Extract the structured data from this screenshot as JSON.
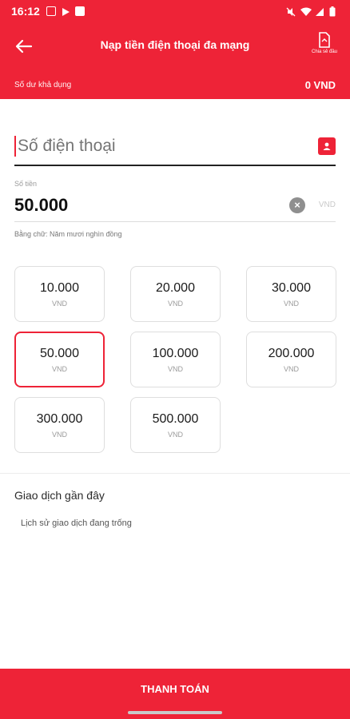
{
  "status_bar": {
    "time": "16:12",
    "left_icons": [
      "image-icon",
      "play-store-icon",
      "calendar-check-icon"
    ],
    "right_icons": [
      "mute-icon",
      "wifi-icon",
      "signal-icon",
      "battery-icon"
    ]
  },
  "header": {
    "title": "Nạp tiền điện thoại đa mạng",
    "share_label": "Chia sẻ đầu",
    "back_icon": "back-arrow-icon"
  },
  "balance": {
    "label": "Số dư khả dụng",
    "value": "0 VND"
  },
  "phone": {
    "placeholder": "Số điện thoại",
    "contact_icon": "contact-book-icon"
  },
  "amount": {
    "label": "Số tiền",
    "value": "50.000",
    "unit": "VND",
    "words": "Bằng chữ: Năm mươi nghìn đồng"
  },
  "denominations": [
    {
      "value": "10.000",
      "unit": "VND",
      "selected": false
    },
    {
      "value": "20.000",
      "unit": "VND",
      "selected": false
    },
    {
      "value": "30.000",
      "unit": "VND",
      "selected": false
    },
    {
      "value": "50.000",
      "unit": "VND",
      "selected": true
    },
    {
      "value": "100.000",
      "unit": "VND",
      "selected": false
    },
    {
      "value": "200.000",
      "unit": "VND",
      "selected": false
    },
    {
      "value": "300.000",
      "unit": "VND",
      "selected": false
    },
    {
      "value": "500.000",
      "unit": "VND",
      "selected": false
    }
  ],
  "recent": {
    "title": "Giao dịch gần đây",
    "empty_text": "Lịch sử giao dịch đang trống"
  },
  "footer": {
    "pay_label": "THANH TOÁN"
  },
  "colors": {
    "brand": "#ee2337",
    "text": "#1a1a1a",
    "muted": "#9a9a9a"
  }
}
